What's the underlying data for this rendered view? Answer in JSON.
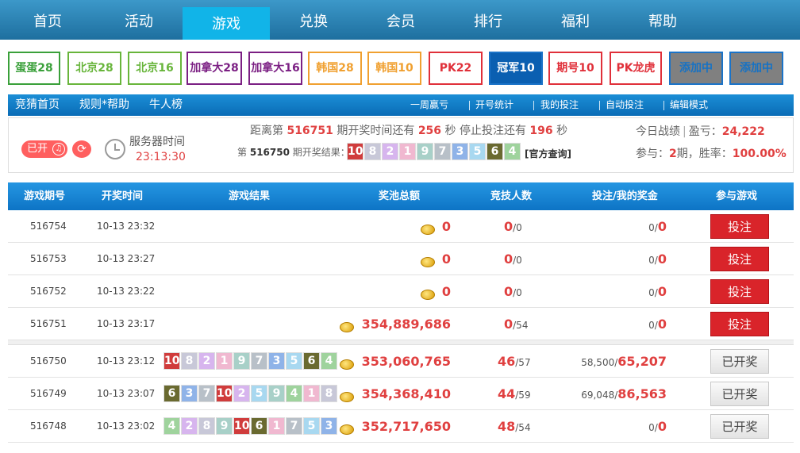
{
  "nav": [
    "首页",
    "活动",
    "游戏",
    "兑换",
    "会员",
    "排行",
    "福利",
    "帮助"
  ],
  "nav_active": 2,
  "games": [
    {
      "label": "蛋蛋28",
      "color": "#3aa03a",
      "bg": "#ffffff"
    },
    {
      "label": "北京28",
      "color": "#68b53b",
      "bg": "#ffffff"
    },
    {
      "label": "北京16",
      "color": "#68b53b",
      "bg": "#ffffff"
    },
    {
      "label": "加拿大28",
      "color": "#7b1f83",
      "bg": "#ffffff"
    },
    {
      "label": "加拿大16",
      "color": "#7b1f83",
      "bg": "#ffffff"
    },
    {
      "label": "韩国28",
      "color": "#f0a030",
      "bg": "#ffffff"
    },
    {
      "label": "韩国10",
      "color": "#f0a030",
      "bg": "#ffffff"
    },
    {
      "label": "PK22",
      "color": "#e0303a",
      "bg": "#ffffff"
    },
    {
      "label": "冠军10",
      "color": "#ffffff",
      "bg": "#0a5fb1"
    },
    {
      "label": "期号10",
      "color": "#e0303a",
      "bg": "#ffffff"
    },
    {
      "label": "PK龙虎",
      "color": "#e0303a",
      "bg": "#ffffff"
    },
    {
      "label": "添加中",
      "color": "#1672c4",
      "bg": "#808080"
    },
    {
      "label": "添加中",
      "color": "#1672c4",
      "bg": "#808080"
    }
  ],
  "subbar": {
    "left": [
      "竞猜首页",
      "规则*帮助",
      "牛人榜"
    ],
    "right": [
      "一周赢亏",
      "开号统计",
      "我的投注",
      "自动投注",
      "编辑模式"
    ]
  },
  "info": {
    "open_label": "已开",
    "server_label": "服务器时间",
    "server_time": "23:13:30",
    "cd_pre": "距离第",
    "cd_issue": "516751",
    "cd_mid1": "期开奖时间还有",
    "cd_sec1": "256",
    "cd_mid2": "秒 停止投注还有",
    "cd_sec2": "196",
    "cd_end": "秒",
    "last_pre": "第",
    "last_issue": "516750",
    "last_mid": "期开奖结果：",
    "last_balls": [
      10,
      8,
      2,
      1,
      9,
      7,
      3,
      5,
      6,
      4
    ],
    "official": "[官方查询]",
    "today_label": "今日战绩",
    "profit_label": "盈亏：",
    "profit": "24,222",
    "part_label": "参与：",
    "part_val": "2",
    "part_unit": "期，胜率：",
    "winrate": "100.00%"
  },
  "columns": [
    "游戏期号",
    "开奖时间",
    "游戏结果",
    "奖池总额",
    "竞技人数",
    "投注/我的奖金",
    "参与游戏"
  ],
  "ball_colors": {
    "1": "#f0b8d0",
    "2": "#d7b5ee",
    "3": "#8fb3e8",
    "4": "#9fd39d",
    "5": "#a8d8f0",
    "6": "#6a6a30",
    "7": "#b8c0c8",
    "8": "#c8c8d8",
    "9": "#a8d0c8",
    "10": "#d03c3c"
  },
  "rows": [
    {
      "issue": "516754",
      "time": "10-13 23:32",
      "balls": [],
      "pool": "0",
      "players": "0",
      "players_total": "/0",
      "bet": "0/",
      "win": "0",
      "action": "投注",
      "state": "bet"
    },
    {
      "issue": "516753",
      "time": "10-13 23:27",
      "balls": [],
      "pool": "0",
      "players": "0",
      "players_total": "/0",
      "bet": "0/",
      "win": "0",
      "action": "投注",
      "state": "bet"
    },
    {
      "issue": "516752",
      "time": "10-13 23:22",
      "balls": [],
      "pool": "0",
      "players": "0",
      "players_total": "/0",
      "bet": "0/",
      "win": "0",
      "action": "投注",
      "state": "bet"
    },
    {
      "issue": "516751",
      "time": "10-13 23:17",
      "balls": [],
      "pool": "354,889,686",
      "players": "0",
      "players_total": "/54",
      "bet": "0/",
      "win": "0",
      "action": "投注",
      "state": "bet"
    },
    {
      "issue": "516750",
      "time": "10-13 23:12",
      "balls": [
        10,
        8,
        2,
        1,
        9,
        7,
        3,
        5,
        6,
        4
      ],
      "pool": "353,060,765",
      "players": "46",
      "players_total": "/57",
      "bet": "58,500/",
      "win": "65,207",
      "action": "已开奖",
      "state": "done"
    },
    {
      "issue": "516749",
      "time": "10-13 23:07",
      "balls": [
        6,
        3,
        7,
        10,
        2,
        5,
        9,
        4,
        1,
        8
      ],
      "pool": "354,368,410",
      "players": "44",
      "players_total": "/59",
      "bet": "69,048/",
      "win": "86,563",
      "action": "已开奖",
      "state": "done"
    },
    {
      "issue": "516748",
      "time": "10-13 23:02",
      "balls": [
        4,
        2,
        8,
        9,
        10,
        6,
        1,
        7,
        5,
        3
      ],
      "pool": "352,717,650",
      "players": "48",
      "players_total": "/54",
      "bet": "0/",
      "win": "0",
      "action": "已开奖",
      "state": "done"
    }
  ]
}
